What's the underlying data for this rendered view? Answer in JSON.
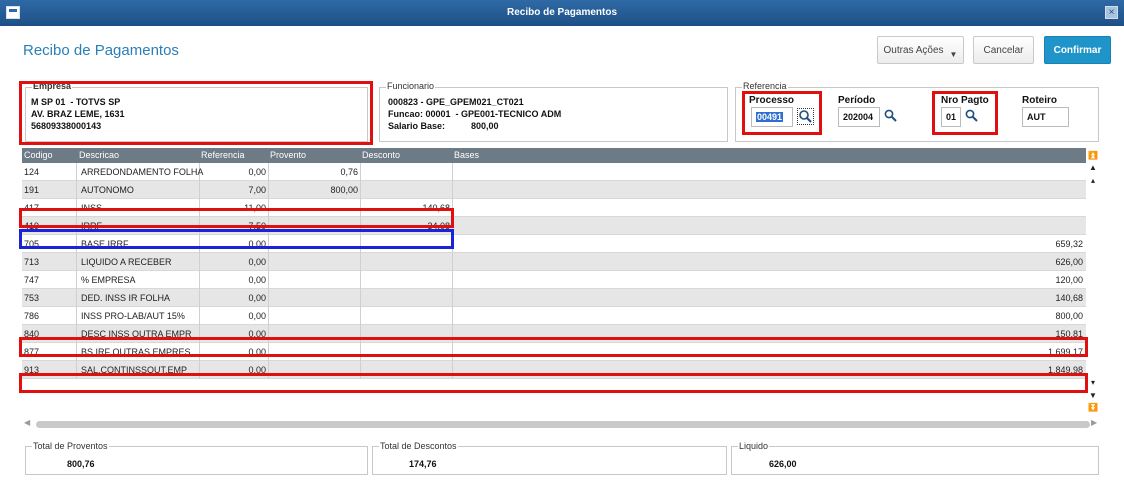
{
  "window": {
    "title": "Recibo de Pagamentos",
    "close_glyph": "×"
  },
  "page": {
    "title": "Recibo de Pagamentos"
  },
  "toolbar": {
    "outras_label": "Outras Ações",
    "cancelar_label": "Cancelar",
    "confirmar_label": "Confirmar",
    "accent": "#1f94c8"
  },
  "empresa": {
    "legend": "Empresa",
    "line1": "M SP 01  - TOTVS SP",
    "line2": "AV. BRAZ LEME, 1631",
    "line3": "56809338000143"
  },
  "funcionario": {
    "legend": "Funcionario",
    "line1": "000823 - GPE_GPEM021_CT021",
    "line2": "Funcao: 00001  - GPE001-TECNICO ADM",
    "salario_label": "Salario Base:",
    "salario_value": "800,00"
  },
  "referencia": {
    "legend": "Referencia",
    "processo_label": "Processo",
    "processo_value": "00491",
    "periodo_label": "Período",
    "periodo_value": "202004",
    "nro_label": "Nro Pagto",
    "nro_value": "01",
    "roteiro_label": "Roteiro",
    "roteiro_value": "AUT"
  },
  "grid": {
    "columns": [
      "Codigo",
      "Descricao",
      "Referencia",
      "Provento",
      "Desconto",
      "Bases"
    ],
    "rows": [
      {
        "codigo": "124",
        "descricao": "ARREDONDAMENTO FOLHA",
        "referencia": "0,00",
        "provento": "0,76",
        "desconto": "",
        "bases": ""
      },
      {
        "codigo": "191",
        "descricao": "AUTONOMO",
        "referencia": "7,00",
        "provento": "800,00",
        "desconto": "",
        "bases": ""
      },
      {
        "codigo": "417",
        "descricao": "INSS",
        "referencia": "11,00",
        "provento": "",
        "desconto": "140,68",
        "bases": ""
      },
      {
        "codigo": "419",
        "descricao": "IRRF",
        "referencia": "7,50",
        "provento": "",
        "desconto": "34,08",
        "bases": ""
      },
      {
        "codigo": "705",
        "descricao": "BASE IRRF",
        "referencia": "0,00",
        "provento": "",
        "desconto": "",
        "bases": "659,32"
      },
      {
        "codigo": "713",
        "descricao": "LIQUIDO A RECEBER",
        "referencia": "0,00",
        "provento": "",
        "desconto": "",
        "bases": "626,00"
      },
      {
        "codigo": "747",
        "descricao": "% EMPRESA",
        "referencia": "0,00",
        "provento": "",
        "desconto": "",
        "bases": "120,00"
      },
      {
        "codigo": "753",
        "descricao": "DED. INSS IR FOLHA",
        "referencia": "0,00",
        "provento": "",
        "desconto": "",
        "bases": "140,68"
      },
      {
        "codigo": "786",
        "descricao": "INSS PRO-LAB/AUT 15%",
        "referencia": "0,00",
        "provento": "",
        "desconto": "",
        "bases": "800,00"
      },
      {
        "codigo": "840",
        "descricao": "DESC INSS OUTRA EMPR",
        "referencia": "0,00",
        "provento": "",
        "desconto": "",
        "bases": "150,81"
      },
      {
        "codigo": "877",
        "descricao": "BS IRF OUTRAS EMPRES",
        "referencia": "0,00",
        "provento": "",
        "desconto": "",
        "bases": "1.699,17"
      },
      {
        "codigo": "913",
        "descricao": "SAL.CONTINSSOUT.EMP",
        "referencia": "0,00",
        "provento": "",
        "desconto": "",
        "bases": "1.849,98"
      }
    ]
  },
  "totals": {
    "proventos_label": "Total de Proventos",
    "proventos_value": "800,76",
    "descontos_label": "Total de Descontos",
    "descontos_value": "174,76",
    "liquido_label": "Liquido",
    "liquido_value": "626,00"
  },
  "highlight_colors": {
    "red": "#e01010",
    "blue": "#1a23d6"
  }
}
